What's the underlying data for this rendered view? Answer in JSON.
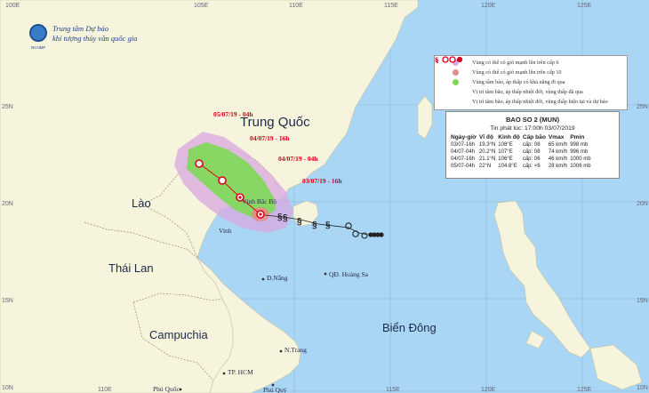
{
  "agency": {
    "line1": "Trung tâm Dự báo",
    "line2": "khí tượng thủy văn quốc gia",
    "emblem_text": "NCHMF"
  },
  "coord_labels": {
    "lon_top": [
      "100E",
      "105E",
      "110E",
      "115E",
      "120E",
      "125E"
    ],
    "lon_bottom": [
      "110E",
      "115E",
      "120E",
      "125E"
    ],
    "lat_left": [
      "25N",
      "20N",
      "15N",
      "10N"
    ],
    "lat_right": [
      "25N",
      "20N",
      "15N",
      "10N"
    ]
  },
  "countries": {
    "china": "Trung Quốc",
    "laos": "Lào",
    "thailand": "Thái Lan",
    "cambodia": "Campuchia",
    "east_sea": "Biển Đông"
  },
  "places": {
    "danang": "Đ.Nẵng",
    "hoangsa": "QĐ. Hoàng Sa",
    "nhatrang": "N.Trang",
    "hcm": "TP. HCM",
    "phuquoc": "Phú Quốc",
    "phuquy": "Phú Quý",
    "vinh": "Vinh",
    "gulf": "Vịnh Bắc Bộ"
  },
  "timestamps": {
    "t1": "05/07/19 - 04h",
    "t2": "04/07/19 - 16h",
    "t3": "04/07/19 - 04h",
    "t4": "03/07/19 - 16h"
  },
  "legend": {
    "items": [
      {
        "label": "Vùng có thể có gió mạnh lên trên cấp 6",
        "color": "#d9a8e0"
      },
      {
        "label": "Vùng có thể có gió mạnh lên trên cấp 10",
        "color": "#e88a88"
      },
      {
        "label": "Vùng tâm bão, áp thấp có khả năng đi qua",
        "color": "#7ed957"
      },
      {
        "label": "Vị trí tâm bão, áp thấp nhiệt đới, vùng thấp đã qua"
      },
      {
        "label": "Vị trí tâm bão, áp thấp nhiệt đới, vùng thấp hiện tại và dự báo"
      }
    ]
  },
  "bulletin": {
    "title": "BAO SO 2 (MUN)",
    "issued": "Tin phát lúc: 17:00h 03/07/2019",
    "headers": [
      "Ngày-giờ",
      "Vĩ độ",
      "Kinh độ",
      "Cấp bão",
      "Vmax",
      "Pmin"
    ],
    "rows": [
      [
        "03/07-16h",
        "19.3°N",
        "108°E",
        "cấp: 08",
        "65 km/h",
        "998 mb"
      ],
      [
        "04/07-04h",
        "20.2°N",
        "107°E",
        "cấp: 08",
        "74 km/h",
        "996 mb"
      ],
      [
        "04/07-16h",
        "21.1°N",
        "106°E",
        "cấp: 06",
        "46 km/h",
        "1000 mb"
      ],
      [
        "05/07-04h",
        "22°N",
        "104.8°E",
        "cấp: <6",
        "28 km/h",
        "1006 mb"
      ]
    ]
  },
  "colors": {
    "sea": "#a9d6f5",
    "land": "#f6f4dc",
    "wind6": "#d9a8e0",
    "wind10": "#e88a88",
    "cone": "#7ed957",
    "current": "#e0001b"
  }
}
